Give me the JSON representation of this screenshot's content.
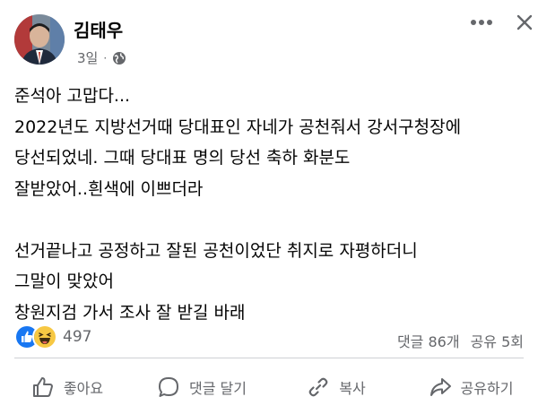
{
  "post": {
    "author": "김태우",
    "time": "3일",
    "separator": "·",
    "privacy_icon": "globe-icon",
    "content_lines": [
      "준석아 고맙다...",
      "2022년도 지방선거때 당대표인 자네가 공천줘서 강서구청장에",
      "당선되었네. 그때 당대표 명의 당선 축하 화분도",
      "잘받았어..흰색에 이쁘더라",
      "",
      "선거끝나고 공정하고 잘된 공천이었단 취지로 자평하더니",
      "그말이 맞았어",
      "창원지검 가서 조사 잘 받길 바래"
    ]
  },
  "stats": {
    "reaction_icons": [
      "like-icon",
      "haha-icon"
    ],
    "reaction_count": "497",
    "comments": "댓글 86개",
    "shares": "공유 5회"
  },
  "actions": {
    "like": "좋아요",
    "comment": "댓글 달기",
    "copy": "복사",
    "share": "공유하기"
  },
  "colors": {
    "text": "#050505",
    "muted": "#65676b",
    "like_blue": "#1877f2",
    "haha_yellow": "#f7c843",
    "divider": "#ced0d4"
  }
}
